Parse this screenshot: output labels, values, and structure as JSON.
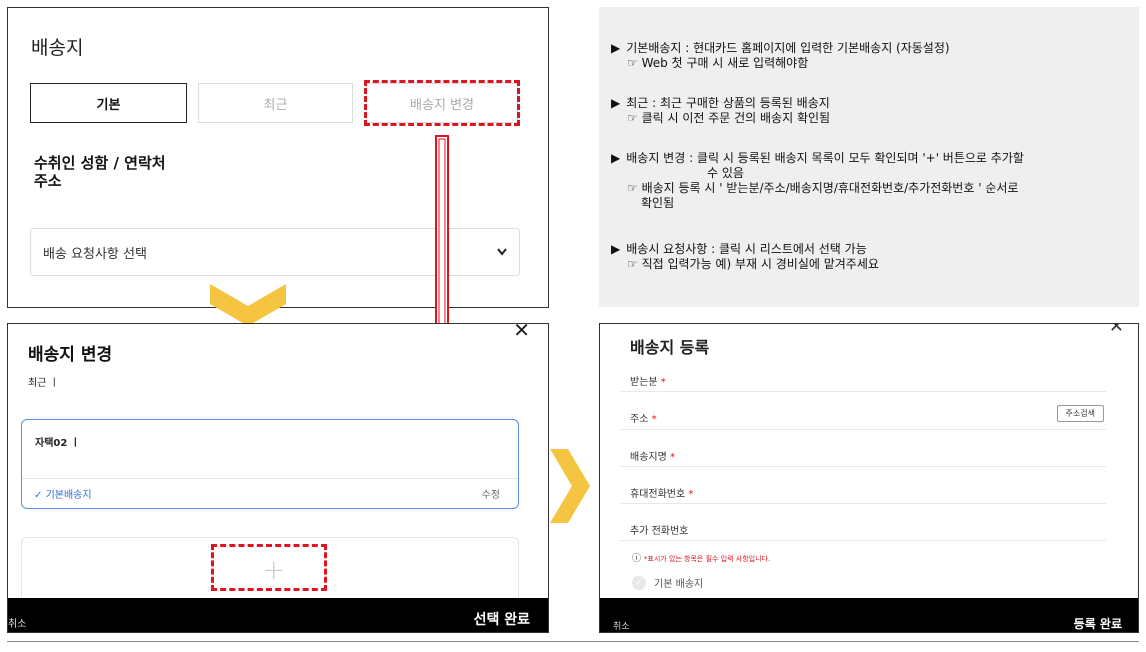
{
  "colors": {
    "accent_red": "#e0141e",
    "arrow_yellow": "#f5c542",
    "link_blue": "#2a6fd6",
    "info_bg": "#efefef"
  },
  "panel1": {
    "title": "배송지",
    "tabs": [
      "기본",
      "최근",
      "배송지 변경"
    ],
    "recipient_line": "수취인 성함 / 연락처",
    "address_line": "주소",
    "request_select": "배송 요청사항 선택",
    "select_icon": "chevron-down-icon"
  },
  "info": [
    {
      "title": "기본배송지 : 현대카드 홈페이지에 입력한 기본배송지 (자동설정)",
      "sub": "Web 첫 구매 시 새로 입력해야함"
    },
    {
      "title": "최근 : 최근 구매한 상품의 등록된 배송지",
      "sub": "클릭 시 이전 주문 건의 배송지 확인됨"
    },
    {
      "title": "배송지 변경 : 클릭 시 등록된 배송지 목록이 모두 확인되며 '+' 버튼으로 추가할",
      "title2": "수 있음",
      "sub": "배송지 등록 시 ' 받는분/주소/배송지명/휴대전화번호/추가전화번호 ' 순서로",
      "sub2": "확인됨"
    },
    {
      "title": "배송시 요청사항 : 클릭 시 리스트에서 선택 가능",
      "sub": "직접 입력가능  예) 부재 시 경비실에 맡겨주세요"
    }
  ],
  "panel2": {
    "title": "배송지 변경",
    "recent_label": "최근 ㅣ",
    "address_name": "자택02 ㅣ",
    "default_label": "기본배송지",
    "edit_label": "수정",
    "add_icon": "plus-icon",
    "cancel_label": "취소",
    "confirm_label": "선택 완료"
  },
  "panel3": {
    "title": "배송지 등록",
    "fields": [
      "받는분",
      "주소",
      "배송지명",
      "휴대전화번호",
      "추가 전화번호"
    ],
    "required_mark": "*",
    "address_search_label": "주소검색",
    "note": "*표시가 있는 항목은 필수 입력 사항입니다.",
    "default_label": "기본 배송지",
    "cancel_label": "취소",
    "confirm_label": "등록 완료"
  }
}
